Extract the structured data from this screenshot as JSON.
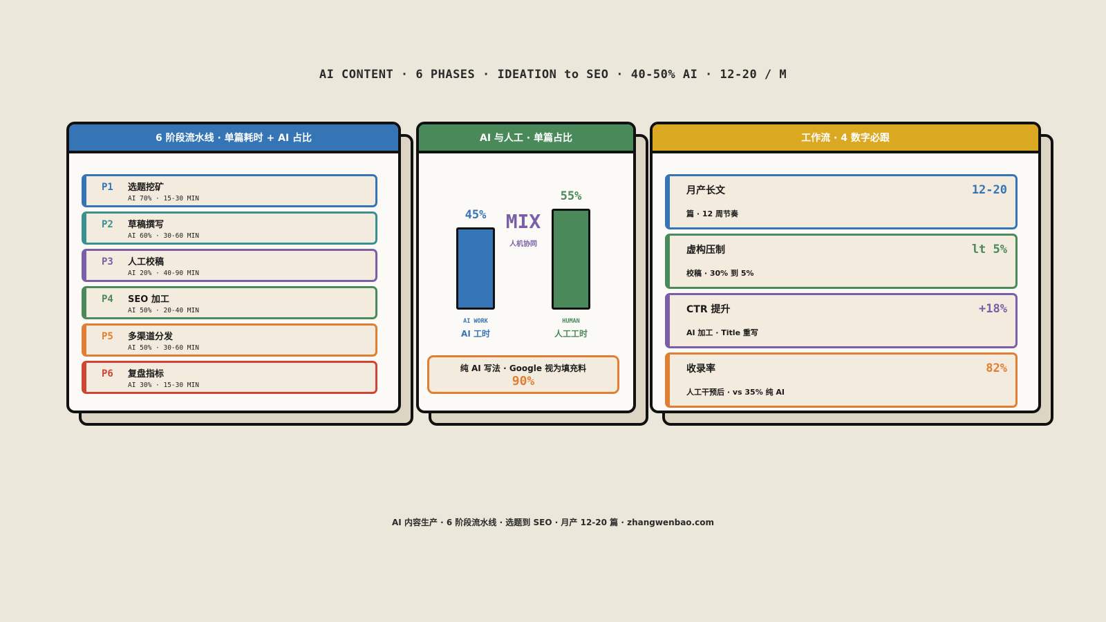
{
  "top_title": "AI CONTENT · 6 PHASES · IDEATION to SEO · 40-50% AI · 12-20 / M",
  "colors": {
    "blue": "#3575b5",
    "teal": "#3a9090",
    "purple": "#7a5fa6",
    "green": "#4a8a5a",
    "orange": "#e07f33",
    "red": "#cf4535",
    "yellow": "#dba822"
  },
  "panel1": {
    "header": "6 阶段流水线 · 单篇耗时 + AI 占比",
    "phases": [
      {
        "code": "P1",
        "name": "选题挖矿",
        "meta": "AI 70% · 15-30 MIN",
        "color": "#3575b5"
      },
      {
        "code": "P2",
        "name": "草稿撰写",
        "meta": "AI 60% · 30-60 MIN",
        "color": "#3a9090"
      },
      {
        "code": "P3",
        "name": "人工校稿",
        "meta": "AI 20% · 40-90 MIN",
        "color": "#7a5fa6"
      },
      {
        "code": "P4",
        "name": "SEO 加工",
        "meta": "AI 50% · 20-40 MIN",
        "color": "#4a8a5a"
      },
      {
        "code": "P5",
        "name": "多渠道分发",
        "meta": "AI 50% · 30-60 MIN",
        "color": "#e07f33"
      },
      {
        "code": "P6",
        "name": "复盘指标",
        "meta": "AI 30% · 15-30 MIN",
        "color": "#cf4535"
      }
    ]
  },
  "panel2": {
    "header": "AI 与人工 · 单篇占比",
    "mix_word": "MIX",
    "mix_sub": "人机协同",
    "bars": [
      {
        "pct_label": "45%",
        "value": 45,
        "en_label": "AI WORK",
        "cn_label": "AI 工时",
        "color": "#3575b5"
      },
      {
        "pct_label": "55%",
        "value": 55,
        "en_label": "HUMAN",
        "cn_label": "人工工时",
        "color": "#4a8a5a"
      }
    ],
    "warn_text": "纯 AI 写法 · Google 视为填充料",
    "warn_pct": "90%"
  },
  "panel3": {
    "header": "工作流 · 4 数字必跟",
    "metrics": [
      {
        "title": "月产长文",
        "sub": "篇 · 12 周节奏",
        "value": "12-20",
        "color": "#3575b5"
      },
      {
        "title": "虚构压制",
        "sub": "校稿 · 30% 到 5%",
        "value": "lt 5%",
        "color": "#4a8a5a"
      },
      {
        "title": "CTR 提升",
        "sub": "AI 加工 · Title 重写",
        "value": "+18%",
        "color": "#7a5fa6"
      },
      {
        "title": "收录率",
        "sub": "人工干预后 · vs 35% 纯 AI",
        "value": "82%",
        "color": "#e07f33"
      }
    ]
  },
  "footer": "AI 内容生产 · 6 阶段流水线 · 选题到 SEO · 月产 12-20 篇 · zhangwenbao.com"
}
